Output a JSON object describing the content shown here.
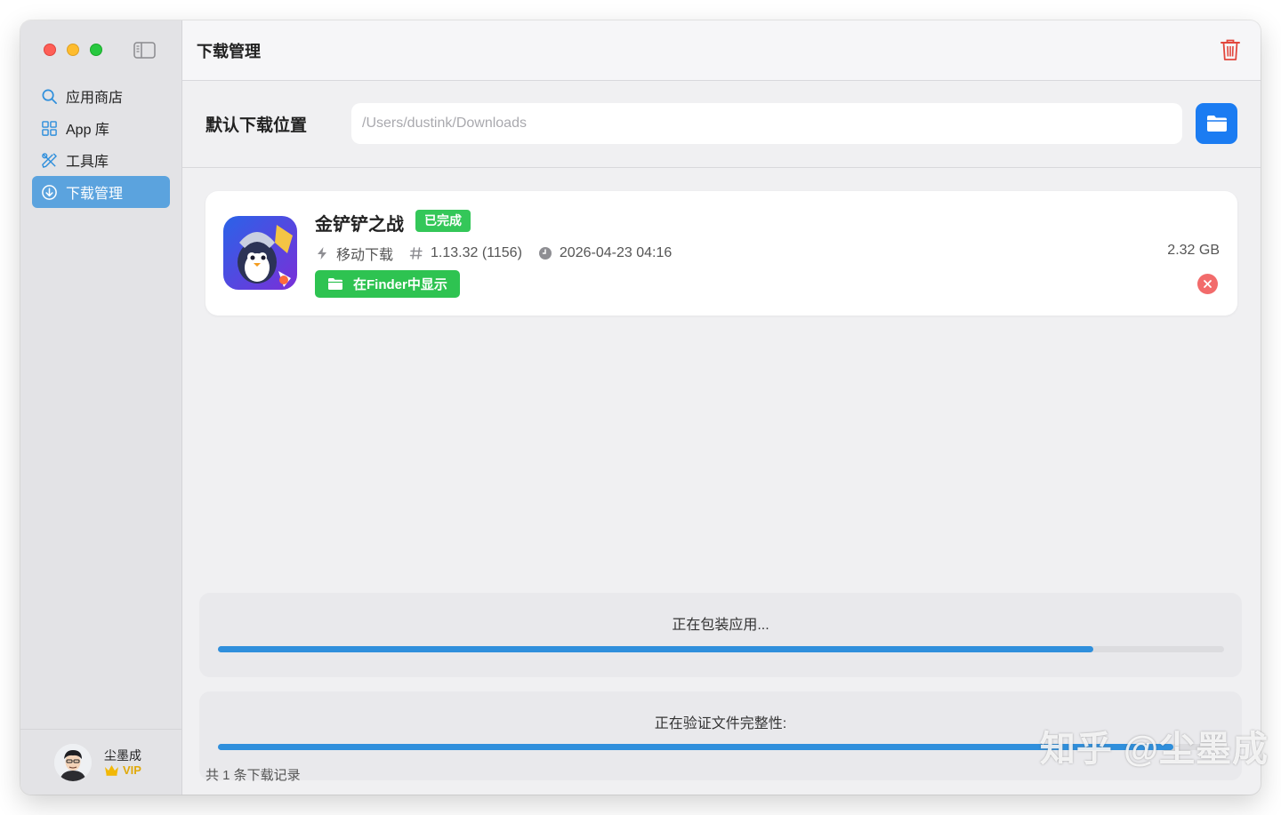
{
  "sidebar": {
    "items": [
      {
        "label": "应用商店",
        "icon": "search-icon"
      },
      {
        "label": "App 库",
        "icon": "grid-icon"
      },
      {
        "label": "工具库",
        "icon": "tools-icon"
      },
      {
        "label": "下载管理",
        "icon": "download-icon",
        "active": true
      }
    ],
    "user": {
      "name": "尘墨成",
      "tier": "VIP"
    }
  },
  "header": {
    "title": "下载管理"
  },
  "location": {
    "label": "默认下载位置",
    "placeholder": "/Users/dustink/Downloads"
  },
  "download": {
    "name": "金铲铲之战",
    "status": "已完成",
    "source": "移动下载",
    "version": "1.13.32 (1156)",
    "datetime": "2026-04-23 04:16",
    "size": "2.32 GB",
    "finder_label": "在Finder中显示"
  },
  "progress": [
    {
      "label": "正在包装应用...",
      "value": 0.87
    },
    {
      "label": "正在验证文件完整性:",
      "value": 0.95
    }
  ],
  "footer": {
    "summary": "共 1 条下载记录"
  },
  "watermark": "知乎 @尘墨成",
  "colors": {
    "accent": "#1b7cf2",
    "active_nav": "#5ba3de",
    "success": "#34c759",
    "danger": "#e2463c",
    "progress": "#2f8fdc"
  }
}
